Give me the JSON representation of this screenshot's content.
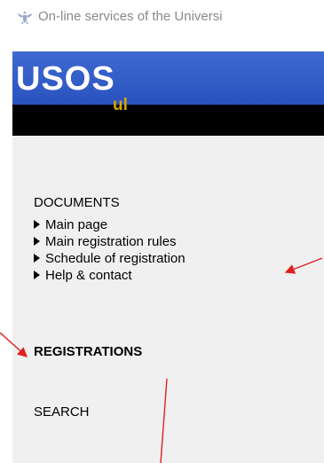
{
  "browser": {
    "tab_title": "On-line services of the Universi",
    "favicon": "university-eagle-icon"
  },
  "brand": {
    "logo_main": "USOS",
    "logo_sub": "ul",
    "colors": {
      "blue": "#2f5bc6",
      "black": "#000000",
      "sub_text": "#d8a400"
    }
  },
  "sidebar": {
    "documents_title": "DOCUMENTS",
    "documents_items": [
      {
        "label": "Main page"
      },
      {
        "label": "Main registration rules"
      },
      {
        "label": "Schedule of registration"
      },
      {
        "label": "Help & contact"
      }
    ],
    "registrations_title": "REGISTRATIONS",
    "search_title": "SEARCH"
  },
  "annotation": {
    "arrow_color": "#e02020"
  }
}
